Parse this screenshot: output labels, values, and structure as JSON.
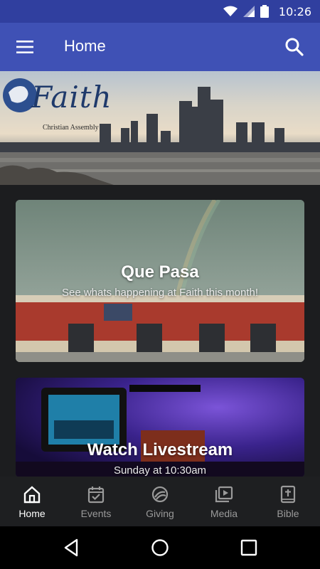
{
  "status_bar": {
    "time": "10:26"
  },
  "app_bar": {
    "title": "Home"
  },
  "hero": {
    "logo_text": "Faith",
    "logo_subtitle": "Christian Assembly"
  },
  "cards": [
    {
      "title": "Que Pasa",
      "subtitle": "See whats happening at Faith this month!"
    },
    {
      "title": "Watch Livestream",
      "subtitle": "Sunday at 10:30am"
    }
  ],
  "bottom_nav": {
    "items": [
      {
        "label": "Home",
        "icon": "home-icon",
        "active": true
      },
      {
        "label": "Events",
        "icon": "calendar-icon",
        "active": false
      },
      {
        "label": "Giving",
        "icon": "giving-icon",
        "active": false
      },
      {
        "label": "Media",
        "icon": "media-icon",
        "active": false
      },
      {
        "label": "Bible",
        "icon": "bible-icon",
        "active": false
      }
    ]
  },
  "colors": {
    "status_bar": "#303f9f",
    "app_bar": "#3f51b5",
    "background": "#1c1d1f",
    "nav_active": "#ffffff",
    "nav_inactive": "#9a9a9a"
  }
}
